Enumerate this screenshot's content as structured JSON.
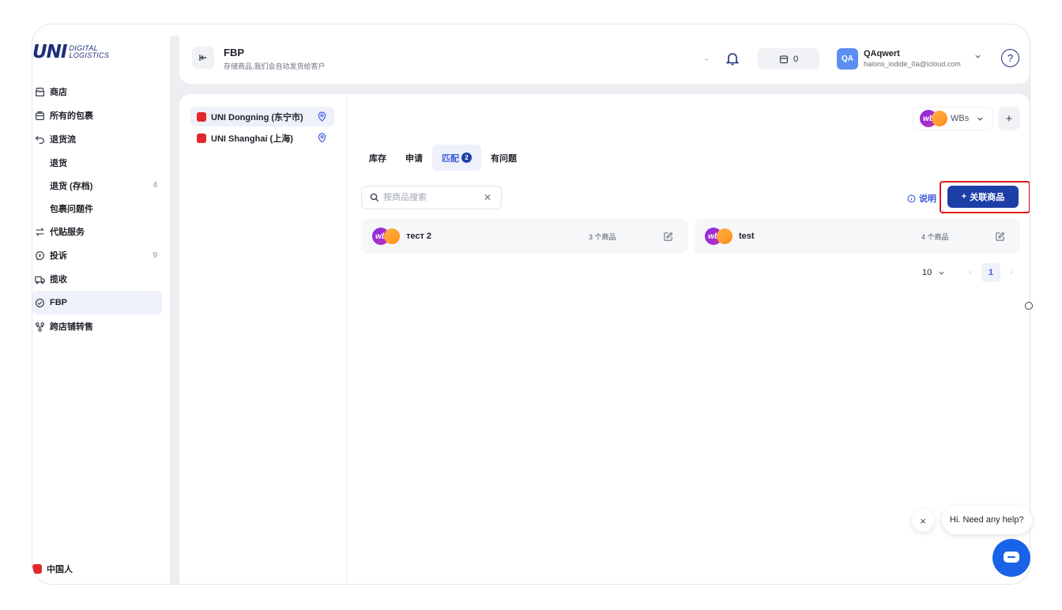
{
  "logo": {
    "main": "UNI",
    "sub_line1": "DIGITAL",
    "sub_line2": "LOGISTICS"
  },
  "sidebar": {
    "items": [
      {
        "label": "商店",
        "icon": "shop-icon"
      },
      {
        "label": "所有的包裹",
        "icon": "package-icon"
      },
      {
        "label": "退货流",
        "icon": "return-icon"
      },
      {
        "label": "退货"
      },
      {
        "label": "退货 (存档)",
        "count": "4"
      },
      {
        "label": "包裹问题件"
      },
      {
        "label": "代贴服务",
        "icon": "swap-icon"
      },
      {
        "label": "投诉",
        "icon": "chat-icon",
        "count": "9"
      },
      {
        "label": "揽收",
        "icon": "truck-icon"
      },
      {
        "label": "FBP",
        "icon": "fbp-icon"
      },
      {
        "label": "跨店铺转售",
        "icon": "share-icon"
      }
    ],
    "footer_label": "中国人"
  },
  "header": {
    "title": "FBP",
    "subtitle": "存储商品,我们会自动发货给客户",
    "box_count": "0",
    "avatar": "QA",
    "user_name": "QAqwert",
    "user_email": "halons_iodide_0a@icloud.com",
    "help": "?"
  },
  "warehouses": [
    {
      "label": "UNI Dongning (东宁市)"
    },
    {
      "label": "UNI Shanghai (上海)"
    }
  ],
  "store_select": {
    "logo": "wb",
    "value": "WBs"
  },
  "add_label": "+",
  "tabs": [
    {
      "label": "库存"
    },
    {
      "label": "申请"
    },
    {
      "label": "匹配",
      "badge": "2"
    },
    {
      "label": "有问题"
    }
  ],
  "search": {
    "placeholder": "按商品搜索",
    "value": ""
  },
  "explain_label": "说明",
  "link_button": {
    "icon": "+",
    "label": "关联商品"
  },
  "cards": [
    {
      "logo": "wb",
      "name": "тест 2",
      "count": "3 个商品"
    },
    {
      "logo": "wb",
      "name": "test",
      "count": "4 个商品"
    }
  ],
  "pagination": {
    "page_size": "10",
    "current_page": "1"
  },
  "help_widget": {
    "text": "Hi. Need any help?",
    "close": "×"
  },
  "colors": {
    "primary": "#1d3fa8",
    "accent": "#3b5bdb",
    "highlight_frame": "#e0151c",
    "chat": "#1863e8"
  }
}
